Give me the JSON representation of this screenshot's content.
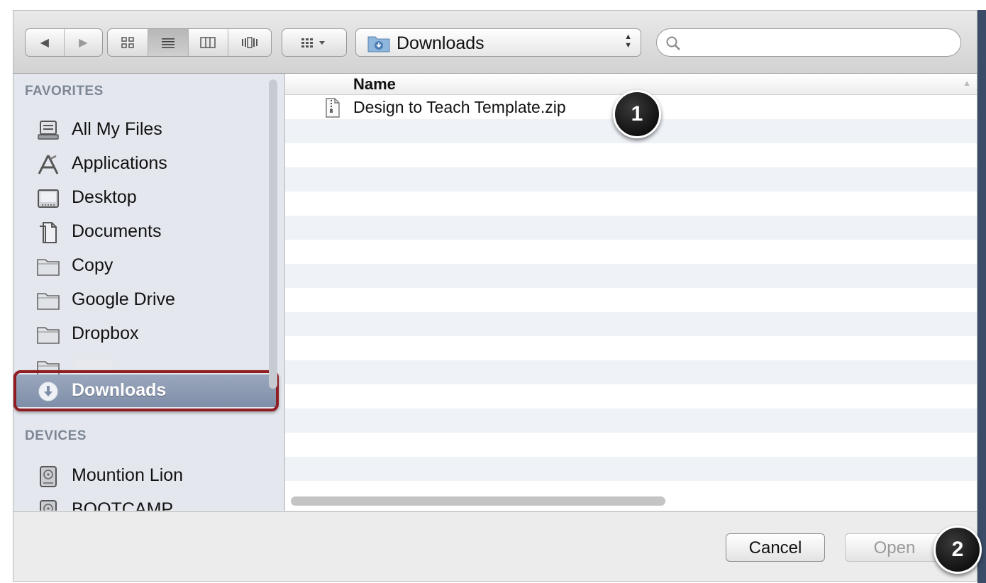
{
  "toolbar": {
    "back_icon": "◀",
    "forward_icon": "▶",
    "view_modes": [
      "icon-view",
      "list-view",
      "column-view",
      "cover-flow-view"
    ],
    "arrange_icon": "arrange-grid-icon",
    "location": "Downloads",
    "search": {
      "value": "",
      "placeholder": ""
    }
  },
  "sidebar": {
    "favorites_header": "FAVORITES",
    "favorites": [
      {
        "label": "All My Files",
        "icon": "all-files-icon"
      },
      {
        "label": "Applications",
        "icon": "applications-icon"
      },
      {
        "label": "Desktop",
        "icon": "desktop-icon"
      },
      {
        "label": "Documents",
        "icon": "documents-icon"
      },
      {
        "label": "Copy",
        "icon": "folder-icon"
      },
      {
        "label": "Google Drive",
        "icon": "folder-icon"
      },
      {
        "label": "Dropbox",
        "icon": "folder-icon"
      },
      {
        "label": "",
        "icon": "folder-icon"
      },
      {
        "label": "Downloads",
        "icon": "downloads-icon",
        "selected": true
      }
    ],
    "devices_header": "DEVICES",
    "devices": [
      {
        "label": "Mountion Lion",
        "icon": "hard-disk-icon"
      },
      {
        "label": "BOOTCAMP",
        "icon": "hard-disk-icon"
      }
    ]
  },
  "file_list": {
    "column_name": "Name",
    "files": [
      {
        "name": "Design to Teach Template.zip",
        "icon": "zip-file-icon"
      }
    ]
  },
  "buttons": {
    "cancel": "Cancel",
    "open": "Open"
  },
  "callouts": {
    "first": "1",
    "second": "2"
  },
  "colors": {
    "highlight_border": "#8f1d22",
    "selection": "#8a98b2",
    "callout": "#000000"
  }
}
